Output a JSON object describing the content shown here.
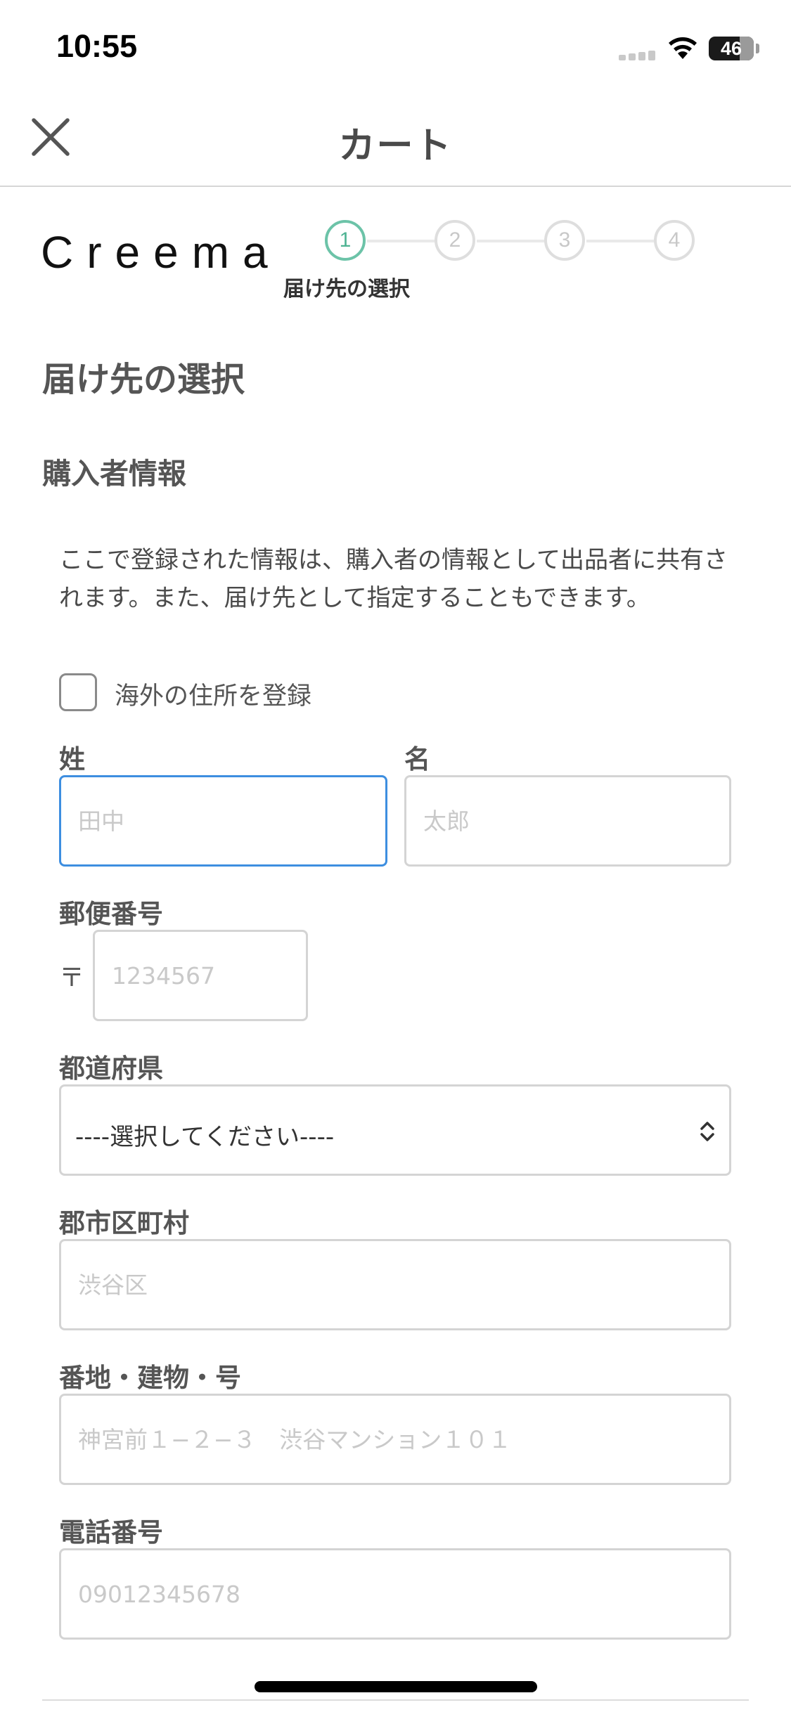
{
  "status_bar": {
    "time": "10:55",
    "battery": "46"
  },
  "header": {
    "title": "カート"
  },
  "logo": {
    "text": "Creema"
  },
  "steps": {
    "items": [
      "1",
      "2",
      "3",
      "4"
    ],
    "current_label": "届け先の選択"
  },
  "page": {
    "title": "届け先の選択"
  },
  "buyer": {
    "section_title": "購入者情報",
    "intro": "ここで登録された情報は、購入者の情報として出品者に共有されます。また、届け先として指定することもできます。",
    "overseas_label": "海外の住所を登録"
  },
  "form": {
    "last_name": {
      "label": "姓",
      "placeholder": "田中"
    },
    "first_name": {
      "label": "名",
      "placeholder": "太郎"
    },
    "postal": {
      "label": "郵便番号",
      "mark": "〒",
      "placeholder": "1234567"
    },
    "prefecture": {
      "label": "都道府県",
      "value": "----選択してください----"
    },
    "city": {
      "label": "郡市区町村",
      "placeholder": "渋谷区"
    },
    "address": {
      "label": "番地・建物・号",
      "placeholder": "神宮前１−２−３　渋谷マンション１０１"
    },
    "phone": {
      "label": "電話番号",
      "placeholder": "09012345678"
    }
  },
  "colors": {
    "accent_step": "#6cc3a8",
    "focus_border": "#3d8ee0"
  }
}
